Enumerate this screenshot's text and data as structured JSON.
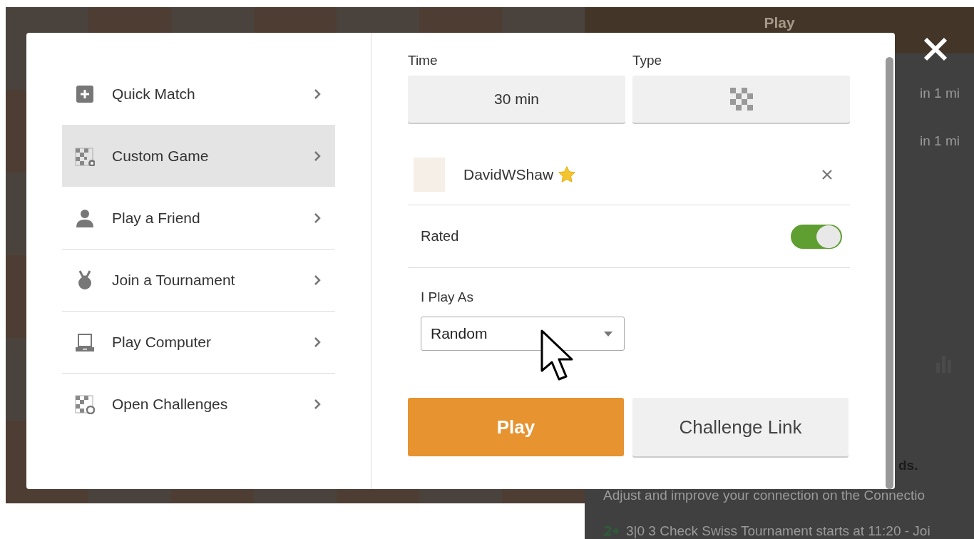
{
  "background": {
    "header": "Play",
    "list": [
      "in 1 mi",
      "in 1 mi"
    ],
    "notice_tail": "ds.",
    "notice": "Adjust and improve your connection on the Connectio",
    "event": "3|0 3 Check Swiss Tournament starts at 11:20 - Joi"
  },
  "modal": {
    "menu": [
      {
        "label": "Quick Match",
        "kind": "plus",
        "selected": false
      },
      {
        "label": "Custom Game",
        "kind": "board-gear",
        "selected": true
      },
      {
        "label": "Play a Friend",
        "kind": "person",
        "selected": false
      },
      {
        "label": "Join a Tournament",
        "kind": "medal",
        "selected": false
      },
      {
        "label": "Play Computer",
        "kind": "laptop",
        "selected": false
      },
      {
        "label": "Open Challenges",
        "kind": "board-circle",
        "selected": false
      }
    ],
    "time_label": "Time",
    "time_value": "30 min",
    "type_label": "Type",
    "opponent": {
      "name": "DavidWShaw",
      "premium": true
    },
    "rated": {
      "label": "Rated",
      "on": true
    },
    "play_as": {
      "label": "I Play As",
      "value": "Random"
    },
    "buttons": [
      {
        "label": "Play",
        "kind": "primary"
      },
      {
        "label": "Challenge Link",
        "kind": "secondary"
      }
    ]
  }
}
